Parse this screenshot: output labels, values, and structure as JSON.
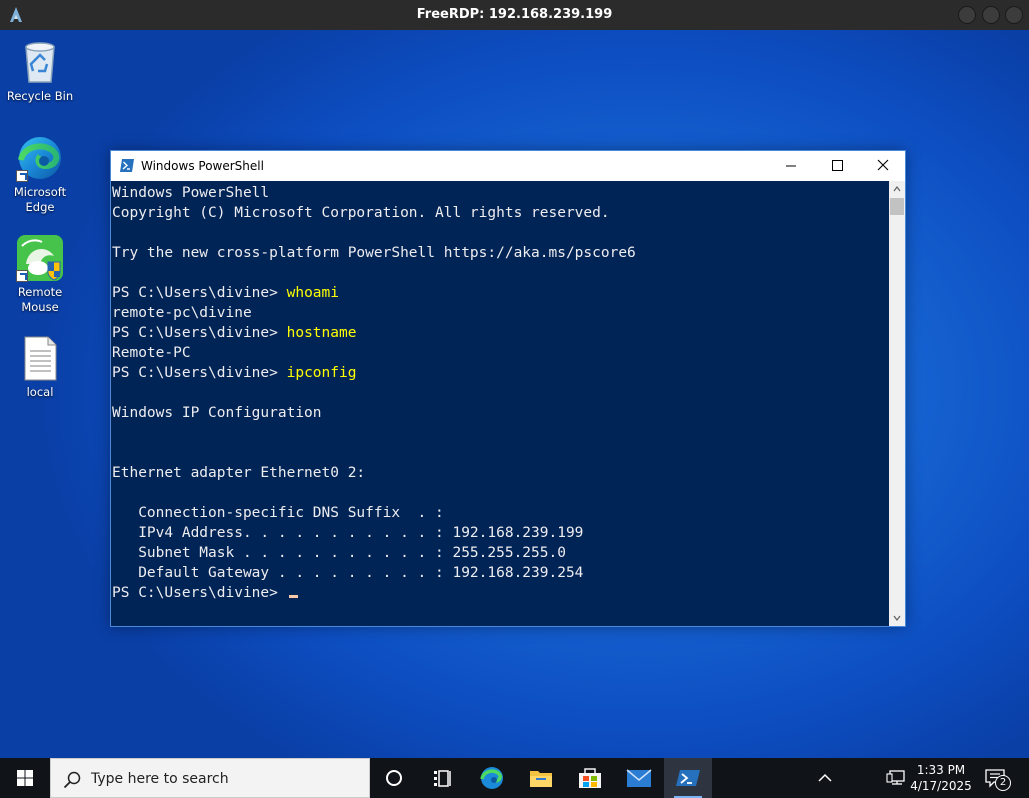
{
  "rdp": {
    "title": "FreeRDP: 192.168.239.199"
  },
  "desktop": {
    "icons": [
      {
        "label": "Recycle Bin",
        "icon": "recycle-bin-icon"
      },
      {
        "label": "Microsoft Edge",
        "icon": "edge-icon"
      },
      {
        "label": "Remote Mouse",
        "icon": "remote-mouse-icon"
      },
      {
        "label": "local",
        "icon": "text-file-icon"
      }
    ]
  },
  "powershell": {
    "title": "Windows PowerShell",
    "lines": [
      {
        "text": "Windows PowerShell"
      },
      {
        "text": "Copyright (C) Microsoft Corporation. All rights reserved."
      },
      {
        "text": ""
      },
      {
        "text": "Try the new cross-platform PowerShell https://aka.ms/pscore6"
      },
      {
        "text": ""
      },
      {
        "prompt": "PS C:\\Users\\divine> ",
        "cmd": "whoami"
      },
      {
        "text": "remote-pc\\divine"
      },
      {
        "prompt": "PS C:\\Users\\divine> ",
        "cmd": "hostname"
      },
      {
        "text": "Remote-PC"
      },
      {
        "prompt": "PS C:\\Users\\divine> ",
        "cmd": "ipconfig"
      },
      {
        "text": ""
      },
      {
        "text": "Windows IP Configuration"
      },
      {
        "text": ""
      },
      {
        "text": ""
      },
      {
        "text": "Ethernet adapter Ethernet0 2:"
      },
      {
        "text": ""
      },
      {
        "text": "   Connection-specific DNS Suffix  . :"
      },
      {
        "text": "   IPv4 Address. . . . . . . . . . . : 192.168.239.199"
      },
      {
        "text": "   Subnet Mask . . . . . . . . . . . : 255.255.255.0"
      },
      {
        "text": "   Default Gateway . . . . . . . . . : 192.168.239.254"
      },
      {
        "prompt": "PS C:\\Users\\divine> ",
        "cmd": "",
        "cursor": true
      }
    ]
  },
  "taskbar": {
    "search_placeholder": "Type here to search",
    "time": "1:33 PM",
    "date": "4/17/2025",
    "notification_count": "2"
  }
}
